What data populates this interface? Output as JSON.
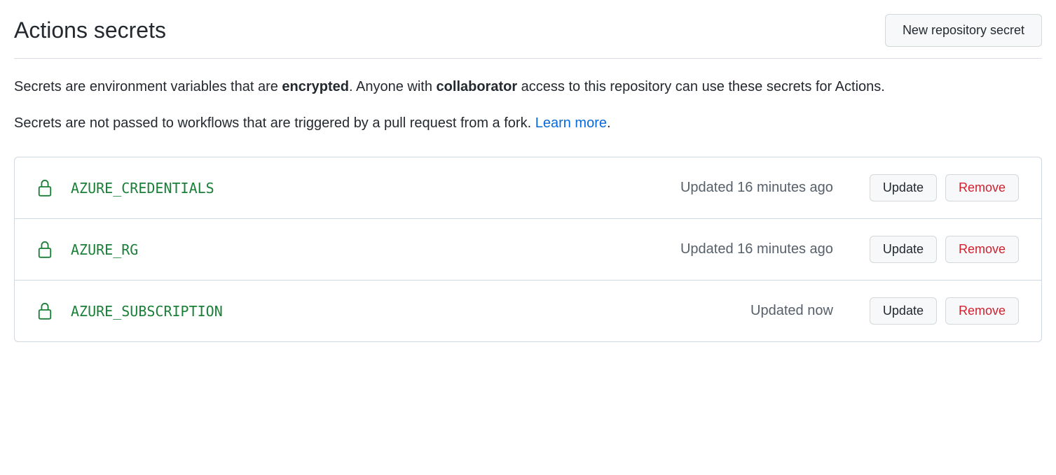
{
  "header": {
    "title": "Actions secrets",
    "new_button_label": "New repository secret"
  },
  "description": {
    "para1_prefix": "Secrets are environment variables that are ",
    "para1_bold1": "encrypted",
    "para1_mid": ". Anyone with ",
    "para1_bold2": "collaborator",
    "para1_suffix": " access to this repository can use these secrets for Actions.",
    "para2_prefix": "Secrets are not passed to workflows that are triggered by a pull request from a fork. ",
    "para2_link": "Learn more",
    "para2_suffix": "."
  },
  "buttons": {
    "update": "Update",
    "remove": "Remove"
  },
  "secrets": [
    {
      "name": "AZURE_CREDENTIALS",
      "updated": "Updated 16 minutes ago"
    },
    {
      "name": "AZURE_RG",
      "updated": "Updated 16 minutes ago"
    },
    {
      "name": "AZURE_SUBSCRIPTION",
      "updated": "Updated now"
    }
  ]
}
